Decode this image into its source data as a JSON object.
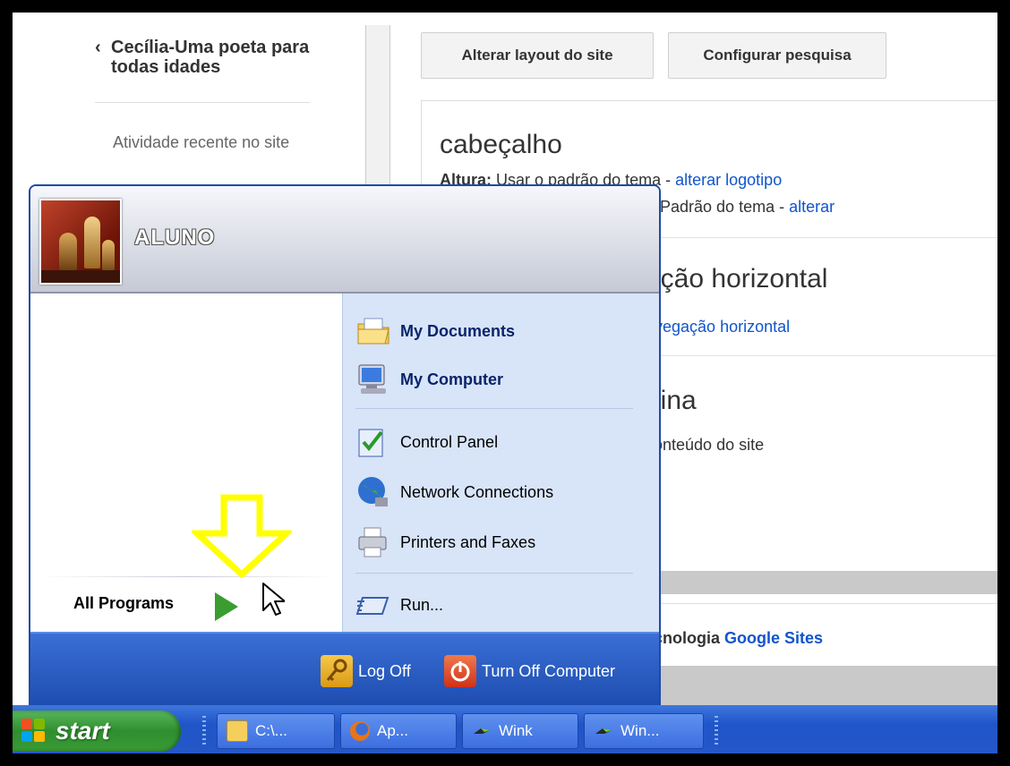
{
  "site": {
    "back_title": "Cecília-Uma poeta para todas idades",
    "recent": "Atividade recente no site",
    "buttons": [
      "Alterar layout do site",
      "Configurar pesquisa"
    ],
    "header_section": {
      "title": "cabeçalho",
      "height_label": "Altura:",
      "height_value": "Usar o padrão do tema",
      "height_link": "alterar logotipo",
      "line2_value": "Padrão do tema",
      "line2_link": "alterar"
    },
    "nav_section": {
      "title": "ação horizontal",
      "link": "avegação horizontal"
    },
    "page_section": {
      "title": "gina",
      "text": "conteúdo do site"
    },
    "footer_prefix": "ecnologia",
    "footer_link": "Google Sites"
  },
  "start_menu": {
    "user": "ALUNO",
    "all_programs": "All Programs",
    "right_items": [
      {
        "label": "My Documents",
        "icon": "folder-documents-icon"
      },
      {
        "label": "My Computer",
        "icon": "computer-icon"
      },
      {
        "label": "Control Panel",
        "icon": "control-panel-icon"
      },
      {
        "label": "Network Connections",
        "icon": "network-globe-icon"
      },
      {
        "label": "Printers and Faxes",
        "icon": "printer-icon"
      },
      {
        "label": "Run...",
        "icon": "run-icon"
      }
    ],
    "log_off": "Log Off",
    "turn_off": "Turn Off Computer"
  },
  "taskbar": {
    "start": "start",
    "items": [
      {
        "label": "C:\\...",
        "icon": "folder-icon"
      },
      {
        "label": "Ap...",
        "icon": "firefox-icon"
      },
      {
        "label": "Wink",
        "icon": "wink-icon"
      },
      {
        "label": "Win...",
        "icon": "wink-icon"
      }
    ]
  },
  "colors": {
    "xp_blue": "#1f4ba4",
    "start_green": "#3a9a35",
    "link": "#1155cc",
    "highlight_arrow": "#ffff00"
  }
}
